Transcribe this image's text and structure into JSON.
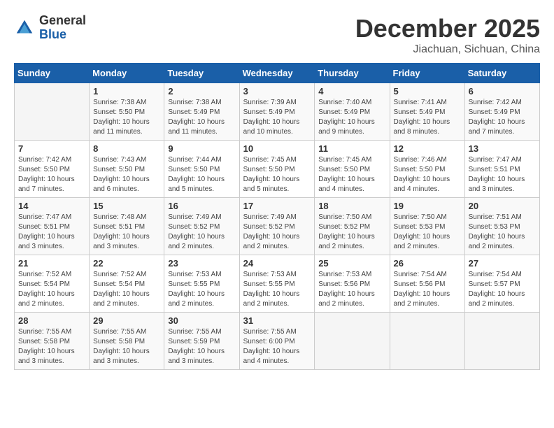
{
  "header": {
    "logo_general": "General",
    "logo_blue": "Blue",
    "month_year": "December 2025",
    "location": "Jiachuan, Sichuan, China"
  },
  "columns": [
    "Sunday",
    "Monday",
    "Tuesday",
    "Wednesday",
    "Thursday",
    "Friday",
    "Saturday"
  ],
  "weeks": [
    [
      {
        "day": "",
        "info": ""
      },
      {
        "day": "1",
        "info": "Sunrise: 7:38 AM\nSunset: 5:50 PM\nDaylight: 10 hours\nand 11 minutes."
      },
      {
        "day": "2",
        "info": "Sunrise: 7:38 AM\nSunset: 5:49 PM\nDaylight: 10 hours\nand 11 minutes."
      },
      {
        "day": "3",
        "info": "Sunrise: 7:39 AM\nSunset: 5:49 PM\nDaylight: 10 hours\nand 10 minutes."
      },
      {
        "day": "4",
        "info": "Sunrise: 7:40 AM\nSunset: 5:49 PM\nDaylight: 10 hours\nand 9 minutes."
      },
      {
        "day": "5",
        "info": "Sunrise: 7:41 AM\nSunset: 5:49 PM\nDaylight: 10 hours\nand 8 minutes."
      },
      {
        "day": "6",
        "info": "Sunrise: 7:42 AM\nSunset: 5:49 PM\nDaylight: 10 hours\nand 7 minutes."
      }
    ],
    [
      {
        "day": "7",
        "info": "Sunrise: 7:42 AM\nSunset: 5:50 PM\nDaylight: 10 hours\nand 7 minutes."
      },
      {
        "day": "8",
        "info": "Sunrise: 7:43 AM\nSunset: 5:50 PM\nDaylight: 10 hours\nand 6 minutes."
      },
      {
        "day": "9",
        "info": "Sunrise: 7:44 AM\nSunset: 5:50 PM\nDaylight: 10 hours\nand 5 minutes."
      },
      {
        "day": "10",
        "info": "Sunrise: 7:45 AM\nSunset: 5:50 PM\nDaylight: 10 hours\nand 5 minutes."
      },
      {
        "day": "11",
        "info": "Sunrise: 7:45 AM\nSunset: 5:50 PM\nDaylight: 10 hours\nand 4 minutes."
      },
      {
        "day": "12",
        "info": "Sunrise: 7:46 AM\nSunset: 5:50 PM\nDaylight: 10 hours\nand 4 minutes."
      },
      {
        "day": "13",
        "info": "Sunrise: 7:47 AM\nSunset: 5:51 PM\nDaylight: 10 hours\nand 3 minutes."
      }
    ],
    [
      {
        "day": "14",
        "info": "Sunrise: 7:47 AM\nSunset: 5:51 PM\nDaylight: 10 hours\nand 3 minutes."
      },
      {
        "day": "15",
        "info": "Sunrise: 7:48 AM\nSunset: 5:51 PM\nDaylight: 10 hours\nand 3 minutes."
      },
      {
        "day": "16",
        "info": "Sunrise: 7:49 AM\nSunset: 5:52 PM\nDaylight: 10 hours\nand 2 minutes."
      },
      {
        "day": "17",
        "info": "Sunrise: 7:49 AM\nSunset: 5:52 PM\nDaylight: 10 hours\nand 2 minutes."
      },
      {
        "day": "18",
        "info": "Sunrise: 7:50 AM\nSunset: 5:52 PM\nDaylight: 10 hours\nand 2 minutes."
      },
      {
        "day": "19",
        "info": "Sunrise: 7:50 AM\nSunset: 5:53 PM\nDaylight: 10 hours\nand 2 minutes."
      },
      {
        "day": "20",
        "info": "Sunrise: 7:51 AM\nSunset: 5:53 PM\nDaylight: 10 hours\nand 2 minutes."
      }
    ],
    [
      {
        "day": "21",
        "info": "Sunrise: 7:52 AM\nSunset: 5:54 PM\nDaylight: 10 hours\nand 2 minutes."
      },
      {
        "day": "22",
        "info": "Sunrise: 7:52 AM\nSunset: 5:54 PM\nDaylight: 10 hours\nand 2 minutes."
      },
      {
        "day": "23",
        "info": "Sunrise: 7:53 AM\nSunset: 5:55 PM\nDaylight: 10 hours\nand 2 minutes."
      },
      {
        "day": "24",
        "info": "Sunrise: 7:53 AM\nSunset: 5:55 PM\nDaylight: 10 hours\nand 2 minutes."
      },
      {
        "day": "25",
        "info": "Sunrise: 7:53 AM\nSunset: 5:56 PM\nDaylight: 10 hours\nand 2 minutes."
      },
      {
        "day": "26",
        "info": "Sunrise: 7:54 AM\nSunset: 5:56 PM\nDaylight: 10 hours\nand 2 minutes."
      },
      {
        "day": "27",
        "info": "Sunrise: 7:54 AM\nSunset: 5:57 PM\nDaylight: 10 hours\nand 2 minutes."
      }
    ],
    [
      {
        "day": "28",
        "info": "Sunrise: 7:55 AM\nSunset: 5:58 PM\nDaylight: 10 hours\nand 3 minutes."
      },
      {
        "day": "29",
        "info": "Sunrise: 7:55 AM\nSunset: 5:58 PM\nDaylight: 10 hours\nand 3 minutes."
      },
      {
        "day": "30",
        "info": "Sunrise: 7:55 AM\nSunset: 5:59 PM\nDaylight: 10 hours\nand 3 minutes."
      },
      {
        "day": "31",
        "info": "Sunrise: 7:55 AM\nSunset: 6:00 PM\nDaylight: 10 hours\nand 4 minutes."
      },
      {
        "day": "",
        "info": ""
      },
      {
        "day": "",
        "info": ""
      },
      {
        "day": "",
        "info": ""
      }
    ]
  ]
}
